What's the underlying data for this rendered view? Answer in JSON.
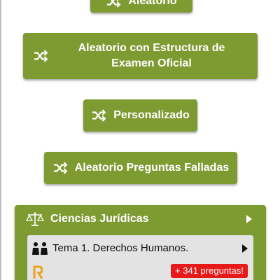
{
  "buttons": {
    "aleatorio": "Aleatorio",
    "examen_oficial": "Aleatorio con Estructura de Examen Oficial",
    "personalizado": "Personalizado",
    "preguntas_falladas": "Aleatorio Preguntas Falladas"
  },
  "category": {
    "title": "Ciencias Jurídicas",
    "icon": "scale-icon",
    "topic": {
      "title": "Tema 1. Derechos Humanos.",
      "icon": "people-icon",
      "badge": "+ 341 preguntas!",
      "r_icon": "r-icon"
    }
  },
  "colors": {
    "button_green": "#7e9b32",
    "topic_bg": "#e3e3e3",
    "badge_red": "#e81919",
    "r_orange": "#f0a020"
  },
  "icons": {
    "shuffle": "shuffle-icon",
    "chevron": "chevron-right-icon"
  }
}
